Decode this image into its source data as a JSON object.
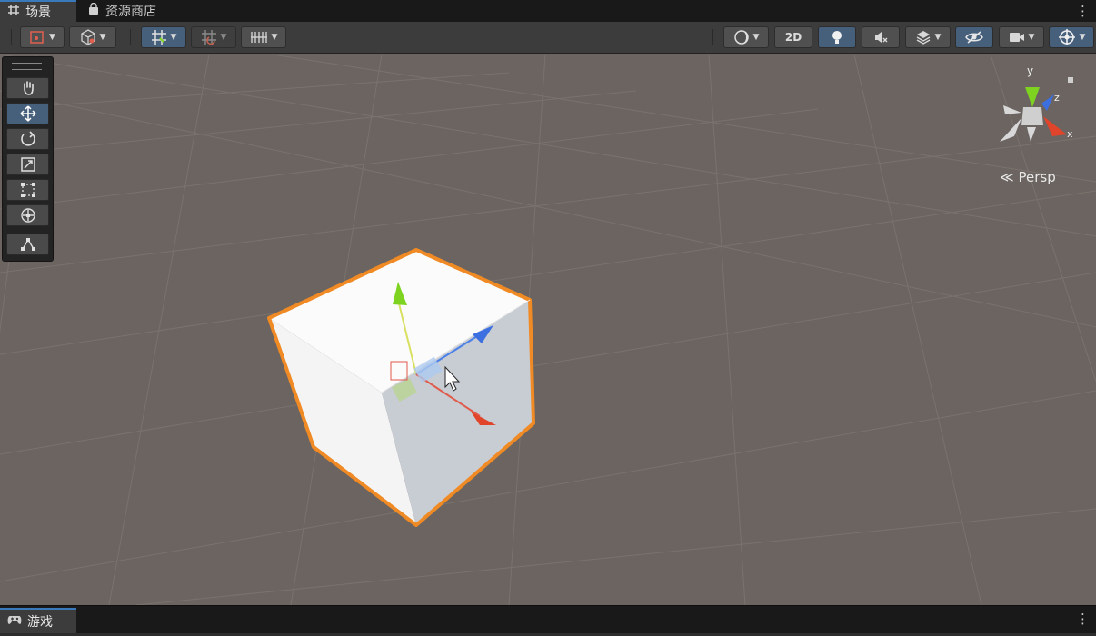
{
  "tabs": [
    {
      "label": "场景",
      "icon": "scene-grid-icon",
      "active": true
    },
    {
      "label": "资源商店",
      "icon": "shopping-bag-icon",
      "active": false
    }
  ],
  "toolbar": {
    "left": [
      {
        "name": "gizmo-draw-mode-dropdown",
        "icon": "draw-mode-icon"
      },
      {
        "name": "render-mode-dropdown",
        "icon": "cube-wireframe-icon"
      },
      {
        "name": "grid-snapping-dropdown",
        "icon": "grid-snap-icon",
        "active": true
      },
      {
        "name": "incremental-snap-dropdown",
        "icon": "increment-snap-icon"
      },
      {
        "name": "grid-visibility-dropdown",
        "icon": "grid-lines-icon"
      }
    ],
    "right": [
      {
        "name": "shading-mode-dropdown",
        "icon": "sphere-icon"
      },
      {
        "name": "2d-toggle-button",
        "label": "2D"
      },
      {
        "name": "lighting-toggle-button",
        "icon": "light-bulb-icon",
        "active": true
      },
      {
        "name": "audio-toggle-button",
        "icon": "audio-mute-icon"
      },
      {
        "name": "effects-dropdown",
        "icon": "layers-icon"
      },
      {
        "name": "scene-visibility-toggle",
        "icon": "eye-hidden-icon",
        "active": true
      },
      {
        "name": "camera-settings-dropdown",
        "icon": "camera-icon"
      },
      {
        "name": "gizmos-dropdown",
        "icon": "gizmos-globe-icon",
        "active": true
      }
    ]
  },
  "tools": [
    {
      "name": "hand-tool",
      "icon": "hand-icon"
    },
    {
      "name": "move-tool",
      "icon": "move-arrows-icon",
      "active": true
    },
    {
      "name": "rotate-tool",
      "icon": "rotate-icon"
    },
    {
      "name": "scale-tool",
      "icon": "scale-icon"
    },
    {
      "name": "rect-tool",
      "icon": "rect-transform-icon"
    },
    {
      "name": "transform-tool",
      "icon": "transform-icon"
    },
    {
      "name": "custom-tool",
      "icon": "custom-editor-tool-icon"
    }
  ],
  "gizmo": {
    "x_label": "x",
    "y_label": "y",
    "z_label": "z",
    "projection": "Persp"
  },
  "bottom_tab": {
    "label": "游戏",
    "icon": "gamepad-icon"
  },
  "colors": {
    "grid_background": "#6b6460",
    "selection_outline": "#f08a24",
    "axis_x": "#e0442a",
    "axis_y": "#7ed321",
    "axis_z": "#3c6fe0",
    "active_button": "#46607c",
    "tab_accent": "#3a79bb"
  }
}
